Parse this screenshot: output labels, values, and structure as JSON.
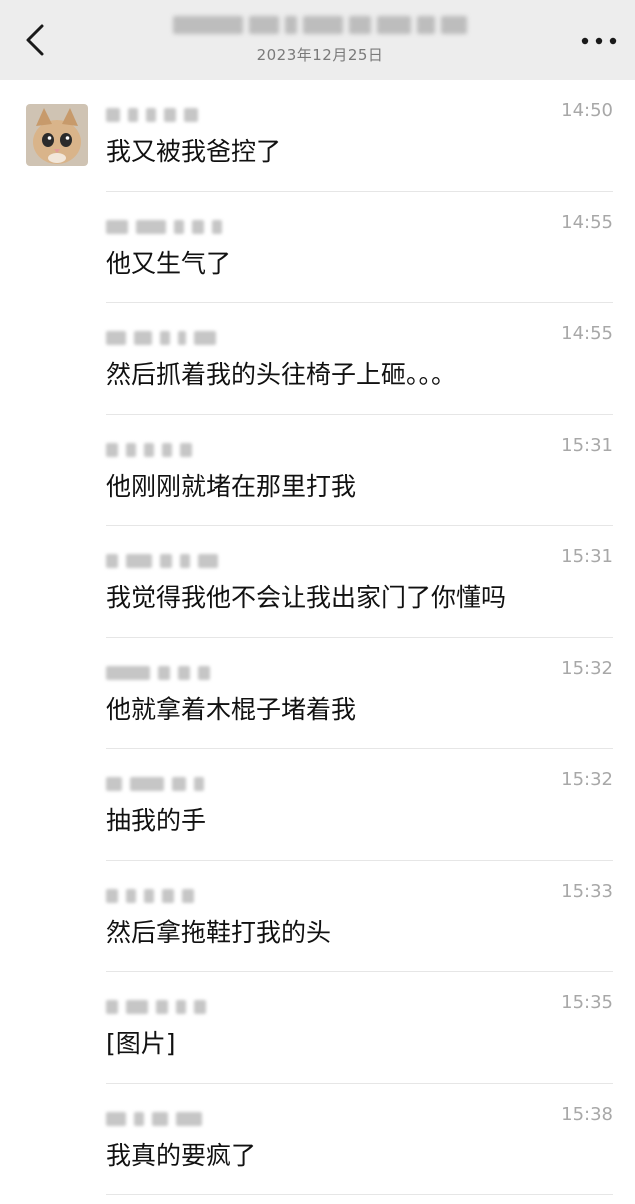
{
  "header": {
    "date": "2023年12月25日",
    "back_icon": "chevron-left-icon",
    "more_icon": "more-dots-icon"
  },
  "messages": [
    {
      "time": "14:50",
      "text": "我又被我爸控了"
    },
    {
      "time": "14:55",
      "text": "他又生气了"
    },
    {
      "time": "14:55",
      "text": "然后抓着我的头往椅子上砸。。。"
    },
    {
      "time": "15:31",
      "text": "他刚刚就堵在那里打我"
    },
    {
      "time": "15:31",
      "text": "我觉得我他不会让我出家门了你懂吗"
    },
    {
      "time": "15:32",
      "text": "他就拿着木棍子堵着我"
    },
    {
      "time": "15:32",
      "text": "抽我的手"
    },
    {
      "time": "15:33",
      "text": "然后拿拖鞋打我的头"
    },
    {
      "time": "15:35",
      "text": "[图片]"
    },
    {
      "time": "15:38",
      "text": "我真的要疯了"
    }
  ]
}
